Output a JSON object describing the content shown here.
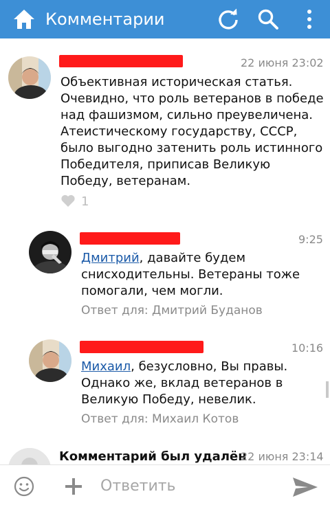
{
  "header": {
    "title": "Комментарии",
    "icons": [
      "home-icon",
      "refresh-icon",
      "search-icon",
      "more-vert-icon"
    ],
    "background": "#3d8fd6"
  },
  "comments": [
    {
      "time": "22 июня 23:02",
      "text": "Объективная историческая статья. Очевидно, что роль ветеранов в победе над фашизмом, сильно преувеличена. Атеистическому государству, СССР, было выгодно затенить роль истинного Победителя, приписав Великую Победу, ветеранам.",
      "likes": "1"
    },
    {
      "time": "9:25",
      "mention": "Дмитрий",
      "text": ", давайте будем снисходительны. Ветераны тоже помогали, чем могли.",
      "reply_to": "Ответ для: Дмитрий Буданов"
    },
    {
      "time": "10:16",
      "mention": "Михаил",
      "text": ", безусловно, Вы правы. Однако же, вклад ветеранов в Великую Победу, невелик.",
      "reply_to": "Ответ для: Михаил Котов"
    },
    {
      "name": "Комментарий был удалён",
      "time": "22 июня 23:14"
    }
  ],
  "composer": {
    "placeholder": "Ответить"
  },
  "colors": {
    "redaction": "#ff1a1a",
    "link": "#1b5aa8",
    "meta": "#8a8a8a"
  }
}
